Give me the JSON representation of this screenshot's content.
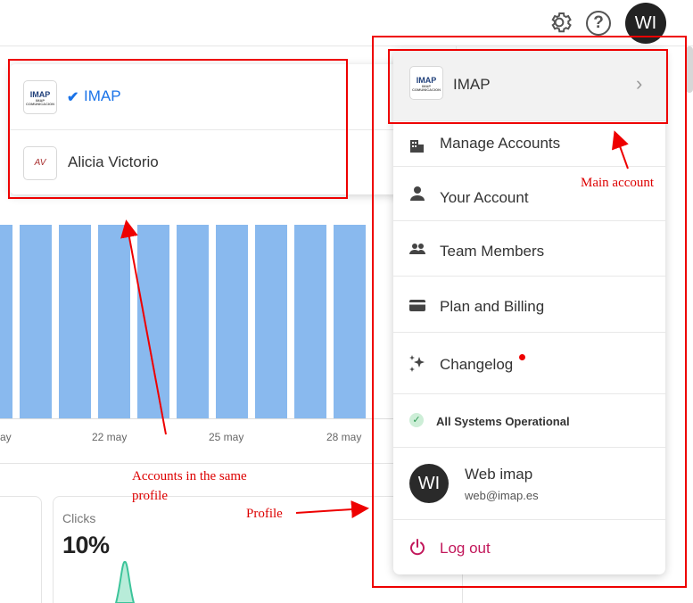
{
  "header": {
    "settings_icon": "gear-icon",
    "help_icon": "help-icon",
    "help_glyph": "?",
    "user_initials": "WI"
  },
  "chart": {
    "x_ticks": [
      "ay",
      "22 may",
      "25 may",
      "28 may"
    ],
    "bar_count": 10
  },
  "stat_card": {
    "label": "Clicks",
    "value": "10%"
  },
  "accounts_dropdown": {
    "items": [
      {
        "logo": "IMAP",
        "logo_sub": "IMAP COMUNICACION",
        "name": "IMAP",
        "selected": true
      },
      {
        "logo": "AV",
        "name": "Alicia Victorio",
        "selected": false
      }
    ]
  },
  "profile_menu": {
    "current_account": {
      "logo": "IMAP",
      "logo_sub": "IMAP COMUNICACION",
      "name": "IMAP"
    },
    "items": [
      {
        "label": "Manage Accounts",
        "icon": "building-icon"
      },
      {
        "label": "Your Account",
        "icon": "person-icon"
      },
      {
        "label": "Team Members",
        "icon": "team-icon"
      },
      {
        "label": "Plan and Billing",
        "icon": "credit-card-icon"
      },
      {
        "label": "Changelog",
        "icon": "sparkles-icon",
        "badge": "new-dot"
      }
    ],
    "status": {
      "label": "All Systems Operational",
      "icon": "check-circle-icon"
    },
    "profile": {
      "initials": "WI",
      "name": "Web imap",
      "email": "web@imap.es"
    },
    "logout": {
      "label": "Log out",
      "icon": "power-icon"
    }
  },
  "annotations": {
    "main_account": "Main account",
    "accounts_same_profile_line1": "Accounts in the same",
    "accounts_same_profile_line2": "profile",
    "profile": "Profile"
  },
  "colors": {
    "accent_blue": "#1a73e8",
    "bar_blue": "#89b9ee",
    "annotation_red": "#e00000",
    "logout_pink": "#c2185b",
    "status_green": "#2e9a55"
  }
}
